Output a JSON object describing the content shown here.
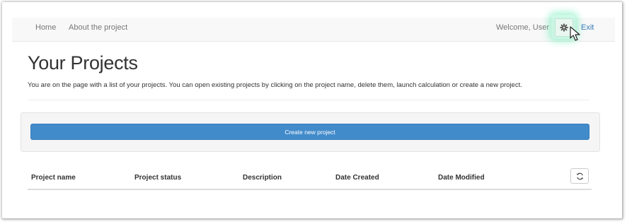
{
  "navbar": {
    "home": "Home",
    "about": "About the project",
    "welcome": "Welcome, User",
    "exit": "Exit"
  },
  "page": {
    "title": "Your Projects",
    "subtitle": "You are on the page with a list of your projects. You can open existing projects by clicking on the project name, delete them, launch calculation or create a new project."
  },
  "actions": {
    "create_label": "Create new project"
  },
  "table": {
    "columns": [
      "Project name",
      "Project status",
      "Description",
      "Date Created",
      "Date Modified"
    ]
  },
  "icons": {
    "settings": "gear-icon",
    "refresh": "refresh-icon",
    "cursor": "mouse-pointer-icon"
  },
  "colors": {
    "primary": "#428bca",
    "link": "#337ab7",
    "highlight": "#7deabf"
  }
}
